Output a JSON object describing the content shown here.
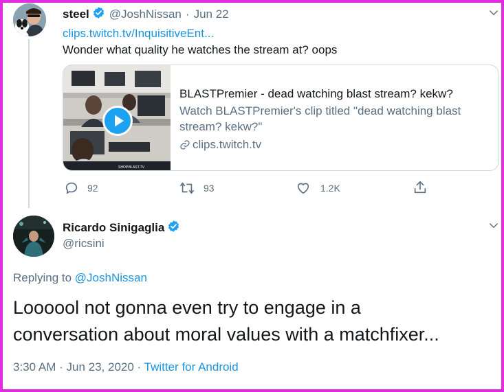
{
  "tweet1": {
    "name": "steel",
    "handle": "@JoshNissan",
    "date_sep": "·",
    "date": "Jun 22",
    "link": "clips.twitch.tv/InquisitiveEnt...",
    "text": "Wonder what quality he watches the stream at? oops",
    "card": {
      "title": "BLASTPremier - dead watching blast stream? kekw?",
      "description": "Watch BLASTPremier's clip titled \"dead watching blast stream? kekw?\"",
      "domain": "clips.twitch.tv",
      "thumb_caption": "SHOP.BLAST.TV"
    },
    "actions": {
      "replies": "92",
      "retweets": "93",
      "likes": "1.2K"
    }
  },
  "tweet2": {
    "name": "Ricardo Sinigaglia",
    "handle": "@ricsini",
    "replying_label": "Replying to",
    "replying_handle": "@JoshNissan",
    "text_line1": "Loooool not gonna even try to engage in a",
    "text_line2": "conversation about moral values with a matchfixer...",
    "time": "3:30 AM",
    "sep1": "·",
    "date": "Jun 23, 2020",
    "sep2": "·",
    "source": "Twitter for Android"
  },
  "colors": {
    "accent": "#1da1f2",
    "link": "#1b95e0",
    "muted": "#5b7083",
    "border": "#cfd9de",
    "frame": "#e22be2"
  },
  "icons": {
    "verified": "verified-badge-icon",
    "chevron": "chevron-down-icon",
    "reply": "reply-icon",
    "retweet": "retweet-icon",
    "like": "heart-icon",
    "share": "share-icon",
    "link": "link-icon",
    "play": "play-icon"
  }
}
